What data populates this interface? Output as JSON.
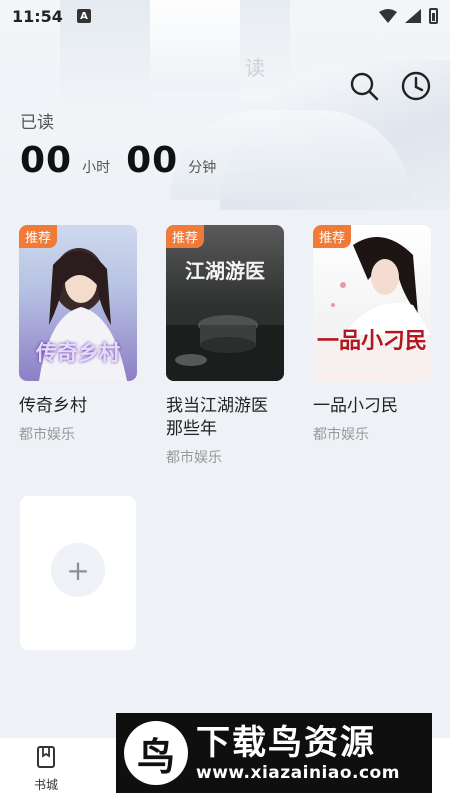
{
  "status": {
    "time": "11:54",
    "a_badge": "A"
  },
  "header": {
    "read_label": "已读",
    "hours": "00",
    "hours_unit": "小时",
    "minutes": "00",
    "minutes_unit": "分钟"
  },
  "icons": {
    "search": "search-icon",
    "history": "clock-icon"
  },
  "books": [
    {
      "title": "传奇乡村",
      "genre": "都市娱乐",
      "badge": "推荐",
      "cover_text": "传奇乡村"
    },
    {
      "title": "我当江湖游医那些年",
      "genre": "都市娱乐",
      "badge": "推荐",
      "cover_text": "江湖游医"
    },
    {
      "title": "一品小刁民",
      "genre": "都市娱乐",
      "badge": "推荐",
      "cover_text": "一品小刁民"
    }
  ],
  "add_button": {
    "symbol": "+"
  },
  "bottom_nav": {
    "store_label": "书城"
  },
  "watermark": {
    "logo_char": "鸟",
    "title": "下载鸟资源",
    "url": "www.xiazainiao.com"
  },
  "colors": {
    "badge": "#f07a38",
    "background": "#eef2f6"
  }
}
